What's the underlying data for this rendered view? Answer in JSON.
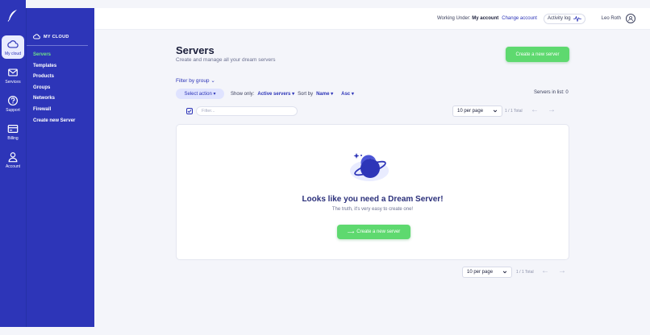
{
  "app": {
    "accent": "#2d35b8",
    "success": "#5ed96f"
  },
  "rail": {
    "items": [
      {
        "label": "My cloud",
        "icon": "cloud-icon"
      },
      {
        "label": "Services",
        "icon": "mail-icon"
      },
      {
        "label": "Support",
        "icon": "help-icon"
      },
      {
        "label": "Billing",
        "icon": "billing-card-icon"
      },
      {
        "label": "Account",
        "icon": "user-icon"
      }
    ]
  },
  "sidebar": {
    "title": "MY CLOUD",
    "items": [
      {
        "label": "Servers"
      },
      {
        "label": "Templates"
      },
      {
        "label": "Products"
      },
      {
        "label": "Groups"
      },
      {
        "label": "Networks"
      },
      {
        "label": "Firewall"
      },
      {
        "label": "Create new Server"
      }
    ]
  },
  "topbar": {
    "working_under": "Working Under:",
    "account": "My account",
    "change_account": "Change account",
    "activity_log": "Activity log",
    "user_name": "Leo Roth"
  },
  "page": {
    "title": "Servers",
    "subtitle": "Create and manage all your dream servers",
    "create_button": "Create a new server"
  },
  "filters": {
    "filter_by_group": "Filter by group",
    "select_action": "Select action",
    "show_only_label": "Show only:",
    "show_only_value": "Active servers",
    "sort_by_label": "Sort by",
    "sort_by_value": "Name",
    "sort_order": "Asc",
    "servers_in_list": "Servers in list: 0",
    "filter_placeholder": "Filter..."
  },
  "pagination": {
    "per_page": "10 per page",
    "total": "1 / 1 Total",
    "prev": "←",
    "next": "→"
  },
  "empty_state": {
    "title": "Looks like you need a Dream Server!",
    "subtitle": "The truth, it's very easy to create one!",
    "button": "Create a new server",
    "button_arrow": "⟶"
  }
}
